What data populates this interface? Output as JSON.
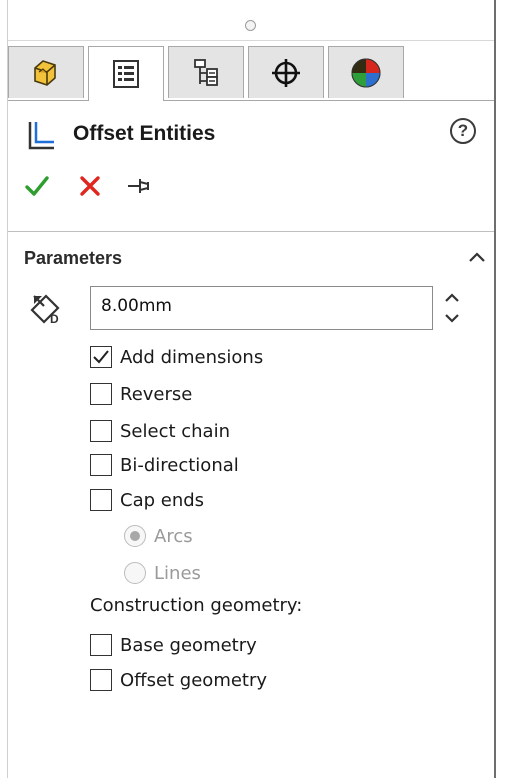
{
  "header": {
    "title": "Offset Entities",
    "help_symbol": "?"
  },
  "tabs": [
    {
      "name": "feature-manager",
      "icon": "part-cube-icon",
      "active": false
    },
    {
      "name": "property-manager",
      "icon": "property-list-icon",
      "active": true
    },
    {
      "name": "configuration-manager",
      "icon": "configuration-tree-icon",
      "active": false
    },
    {
      "name": "dimxpert-manager",
      "icon": "crosshair-target-icon",
      "active": false
    },
    {
      "name": "display-manager",
      "icon": "color-pie-icon",
      "active": false
    }
  ],
  "actions": {
    "ok": "ok-check-icon",
    "cancel": "cancel-x-icon",
    "pin": "pushpin-icon"
  },
  "parameters": {
    "section_title": "Parameters",
    "offset_distance": "8.00mm",
    "checkboxes": [
      {
        "label": "Add dimensions",
        "checked": true
      },
      {
        "label": "Reverse",
        "checked": false
      },
      {
        "label": "Select chain",
        "checked": false
      },
      {
        "label": "Bi-directional",
        "checked": false
      },
      {
        "label": "Cap ends",
        "checked": false
      }
    ],
    "cap_options": [
      {
        "label": "Arcs",
        "selected": true
      },
      {
        "label": "Lines",
        "selected": false
      }
    ],
    "construction_label": "Construction geometry:",
    "construction_checkboxes": [
      {
        "label": "Base geometry",
        "checked": false
      },
      {
        "label": "Offset geometry",
        "checked": false
      }
    ]
  },
  "colors": {
    "ok_green": "#2e9e2e",
    "cancel_red": "#e0261e",
    "tab_bg": "#e4e4e4",
    "border": "#a8a8a8"
  }
}
